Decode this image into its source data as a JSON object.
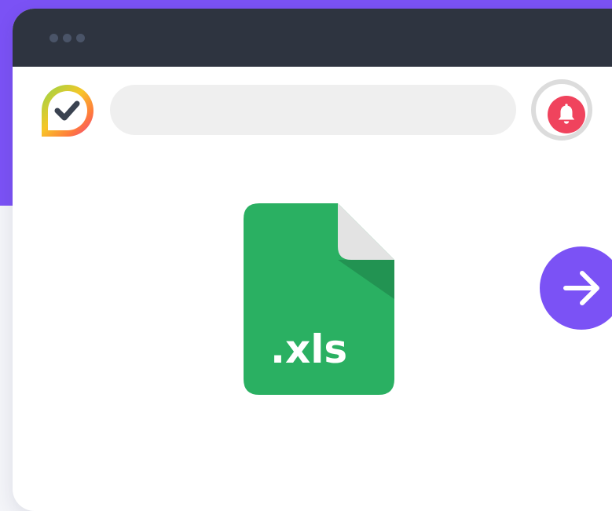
{
  "colors": {
    "page_bg": "#f3f4f8",
    "accent_purple": "#7b52f5",
    "titlebar_dark": "#2e3440",
    "titlebar_dots": "#4a5468",
    "search_bg": "#efefef",
    "bell_ring": "#dcdcdc",
    "bell_red": "#f0435d",
    "xls_green": "#2ab062",
    "xls_fold_shadow": "#229352",
    "xls_fold": "#e3e3e3",
    "white": "#ffffff",
    "checkmark": "#3a4250"
  },
  "icons": {
    "logo": "checkmark-logo-icon",
    "notification": "bell-icon",
    "file": "xls-file-icon",
    "next": "arrow-right-icon"
  },
  "search": {
    "placeholder": "",
    "value": ""
  },
  "file": {
    "extension_label": ".xls"
  }
}
